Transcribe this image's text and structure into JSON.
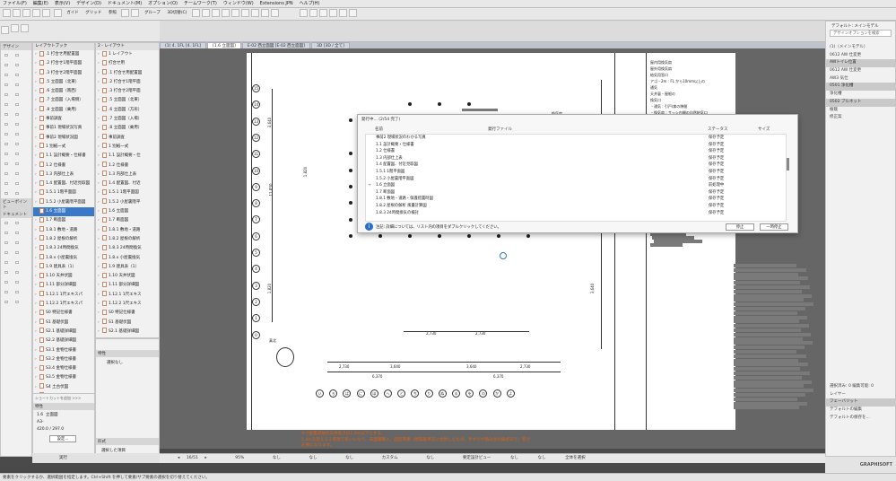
{
  "menu": [
    "ファイル(F)",
    "編集(E)",
    "表示(V)",
    "デザイン(D)",
    "ドキュメント(M)",
    "オプション(O)",
    "チームワーク(T)",
    "ウィンドウ(W)",
    "Extensions JPN",
    "ヘルプ(H)"
  ],
  "toolbar": {
    "guide": "ガイド",
    "grid": "グリッド",
    "ref": "参照",
    "group": "グループ",
    "view3d": "3D切替(C)"
  },
  "left_panel": {
    "design": "デザイン",
    "viewpoint": "ビューポイント",
    "document": "ドキュメント",
    "search": "レイアウトブック",
    "layout_tab": "2 - レイアウト",
    "attr": "特性",
    "scale": "1.6",
    "view_name": "立面図",
    "size_label": "A3-",
    "dims": "420.0 / 297.0",
    "settings": "設定...",
    "shortcut": "ショートカットを追加 >>>"
  },
  "tree_left": [
    ".1 打合せ用配置図",
    ".2 打合せ1階平面図",
    ".3 打合せ2階平面図",
    ".5 立面図（北東）",
    ".6 立面図（南西）",
    ".7 立面図（入場側）",
    ".8 立面図（乗用）",
    "事前調査",
    "事前1 現場状況写真",
    "事前2 現場状況図",
    "1 別紙一式",
    "1.1 設計概要・仕様書",
    "1.2 仕様書",
    "1.3 内部仕上表",
    "1.4 配置図、付近見取図",
    "1.5.1 1階平面図",
    "1.5.2 小屋裏階平面図",
    "1.6 立面図",
    "1.7 断面図",
    "1.8.1 敷地・道路",
    "1.8.2 屋根の解析",
    "1.8.3 24時間換気",
    "1.8.x 小屋裏換気",
    "1.9 建具表（1）",
    "1.10 天井伏図",
    "1.11 部分詳細図",
    "1.12.1 1尺エキスパ",
    "1.12.2 1尺エキスパ",
    "S0 特記仕様書",
    "S1 基礎伏図",
    "S2.1 基礎詳細図",
    "S2.2 基礎詳細図",
    "S3.1 金物仕様書",
    "S3.2 金物仕様書",
    "S3.4 金物仕様書",
    "S3.5 金物仕様書",
    "S4 土台伏図",
    "S5 2階床伏図"
  ],
  "tree_mid": [
    "1 レイアウト",
    "打合せ用",
    ".1 打合せ用配置図",
    ".2 打合せ1階平面",
    ".3 打合せ2階平面",
    ".5 立面図（北東）",
    ".6 立面図（方形）",
    ".7 立面図（入場）",
    ".8 立面図（乗用）",
    "事前調査",
    "1 別紙一式",
    "1.1 設計概要・仕",
    "1.2 仕様書",
    "1.3 内部仕上表",
    "1.4 配置図、付近",
    "1.5.1 1階平面図",
    "1.5.2 小屋裏階平",
    "1.6 立面図",
    "1.7 断面図",
    "1.8.1 敷地・道路",
    "1.8.2 屋根の解析",
    "1.8.3 24時間換気",
    "1.8.x 小屋裏換気",
    "1.9 建具表（1）",
    "1.10 天井伏図",
    "1.11 部分詳細図",
    "1.12.1 1尺エキス",
    "1.12.2 1尺エキス",
    "S0 特記仕様書",
    "S1 基礎伏図",
    "S2.1 基礎詳細図"
  ],
  "mid_bottom": {
    "attr": "特性",
    "choose": "選択なし",
    "format": "形式",
    "selected_item": "選択した項目",
    "run": "実行"
  },
  "tabs": [
    "(1) 4. 1FL [4. 1FL]",
    "[1.6 立面図]",
    "E-02 西立面図 [E-02 西立面図]",
    "3D [3D / 全て]"
  ],
  "drawing": {
    "row_labels": [
      "15",
      "14",
      "13",
      "12",
      "11",
      "10",
      "9",
      "8",
      "7",
      "6",
      "5",
      "4",
      "3",
      "2",
      "1",
      "0"
    ],
    "col_labels": [
      "い",
      "ろ",
      "は",
      "に",
      "ほ",
      "へ",
      "と",
      "ち",
      "り",
      "ぬ",
      "る",
      "を",
      "わ",
      "か",
      "よ"
    ],
    "dims_top": [
      "3,640",
      "2,275",
      "1,820"
    ],
    "dims_left": [
      "11,830",
      "3,640",
      "1,820",
      "1,820"
    ],
    "dims_bottom": [
      "2,730",
      "3,640",
      "3,640",
      "2,730"
    ],
    "dims_total": [
      "6,370",
      "6,370"
    ],
    "dims_right": "3,640",
    "dims_mid": [
      "2,730",
      "2,730"
    ],
    "north": "真北",
    "legend": [
      "屋内用換気扇",
      "屋外用換気扇",
      "給気用窓口",
      "アゴ・2m : FL から10mm以上の",
      "通気",
      "天井裏・屋根の",
      "換気口",
      "・通気 : 引戸/扉の隙間",
      "・換気扇 : サッシ内開の自然給気口"
    ],
    "note": "換気扇"
  },
  "dialog": {
    "title": "発行中... (2/54 完了)",
    "col_name": "名前",
    "col_file": "発行ファイル",
    "col_status": "ステータス",
    "col_size": "サイズ",
    "rows": [
      {
        "name": "事前2 現場状況のわかる写真",
        "status": "保存予定"
      },
      {
        "name": "1.1 設計概要・仕様書",
        "status": "保存予定"
      },
      {
        "name": "1.2 仕様書",
        "status": "保存予定"
      },
      {
        "name": "1.3 内部仕上表",
        "status": "保存予定"
      },
      {
        "name": "1.4 配置図、付近見取図",
        "status": "保存予定"
      },
      {
        "name": "1.5.1 1階平面図",
        "status": "保存予定"
      },
      {
        "name": "1.5.2 小屋裏階平面図",
        "status": "保存予定"
      },
      {
        "name": "1.6 立面図",
        "status": "前処理中"
      },
      {
        "name": "1.7 断面図",
        "status": "保存予定"
      },
      {
        "name": "1.8.1 敷地・道路・保護措置時図",
        "status": "保存予定"
      },
      {
        "name": "1.8.2 屋根の解析 風量計算図",
        "status": "保存予定"
      },
      {
        "name": "1.8.3 24時間換気の検討",
        "status": "保存予定"
      }
    ],
    "note": "注記: 詳細については、リスト内の項目をダブルクリックしてください。",
    "btn_stop": "停止",
    "btn_pause": "一時停止"
  },
  "right_panel": {
    "header": "デフォルト: メインモデル",
    "search": "デザインオプションを検索",
    "items": [
      "(1)（メインモデル）",
      "0612 AW 仕変更",
      "AWトイレ位置",
      "0612 AW 仕変更",
      "AW3 気仕",
      "0501 浄化槽",
      "浄化槽",
      "0502 プルネット",
      "植栽",
      "修正案"
    ],
    "bottom": {
      "sel": "選択済み: 0 編集可能: 0",
      "layer": "レイヤー",
      "favorites": "フェーバリット",
      "default_edit": "デフォルトの編集",
      "default_save": "デフォルトの保存を...",
      "company": "GRAPHISOFT"
    }
  },
  "nav": {
    "page": "16/51",
    "zoom": "95%",
    "none1": "なし",
    "none2": "なし",
    "none3": "なし",
    "custom": "カスタム",
    "none4": "なし",
    "view": "要定設計ビュー",
    "none5": "なし",
    "none6": "なし",
    "fit": "全体を選択"
  },
  "warning": [
    "※小屋裏収納の天井高さは1.4m以下とする。",
    "1.4mを超える２階建て扱いになり、床面積算入、固定荷重（建築基準法に合致したもの、手すりや踏み台の様式あり）等が",
    "必要になります。"
  ],
  "status": "要素をクリックするか、選択範囲を指定します。Ctrl+Shift を押して要素/サブ要素の選択を切り替えてください。",
  "left_bottom_labels": [
    "ID",
    "図面",
    "1.6",
    "立面図"
  ]
}
